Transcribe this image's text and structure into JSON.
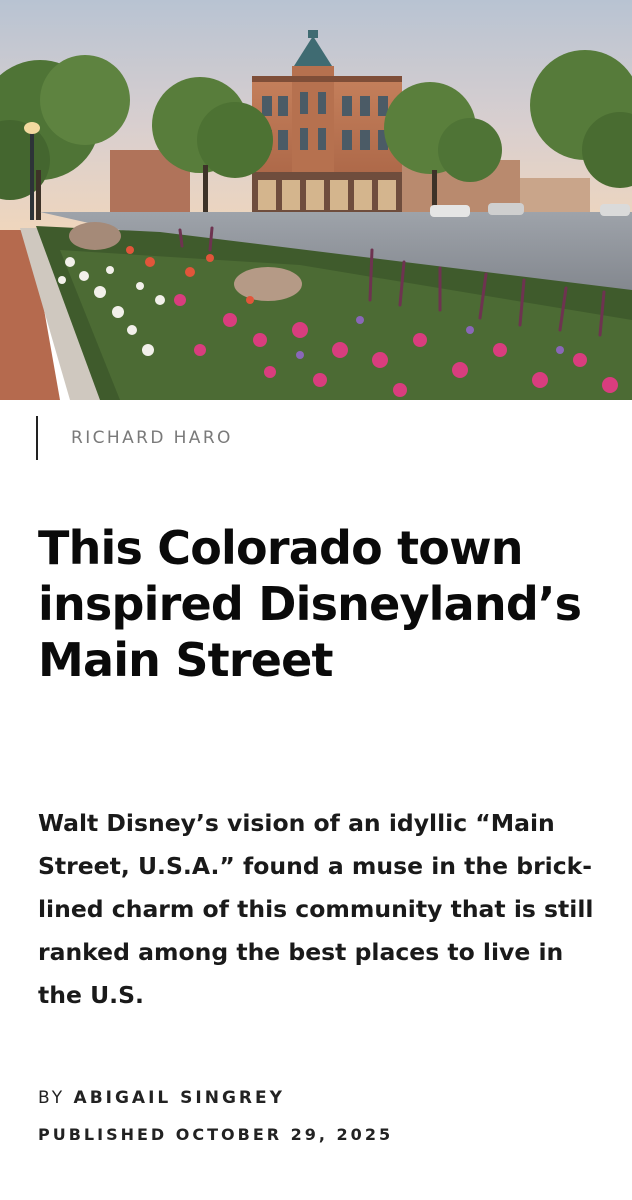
{
  "hero": {
    "image_alt": "Flower bed in front of a historic brick corner building on a town main street"
  },
  "photo_credit": "RICHARD HARO",
  "headline": "This Colorado town inspired Disneyland’s Main Street",
  "dek": "Walt Disney’s vision of an idyllic “Main Street, U.S.A.” found a muse in the brick-lined charm of this community that is still ranked among the best places to live in the U.S.",
  "byline": {
    "prefix": "BY",
    "author": "ABIGAIL SINGREY"
  },
  "published": "PUBLISHED OCTOBER 29, 2025"
}
